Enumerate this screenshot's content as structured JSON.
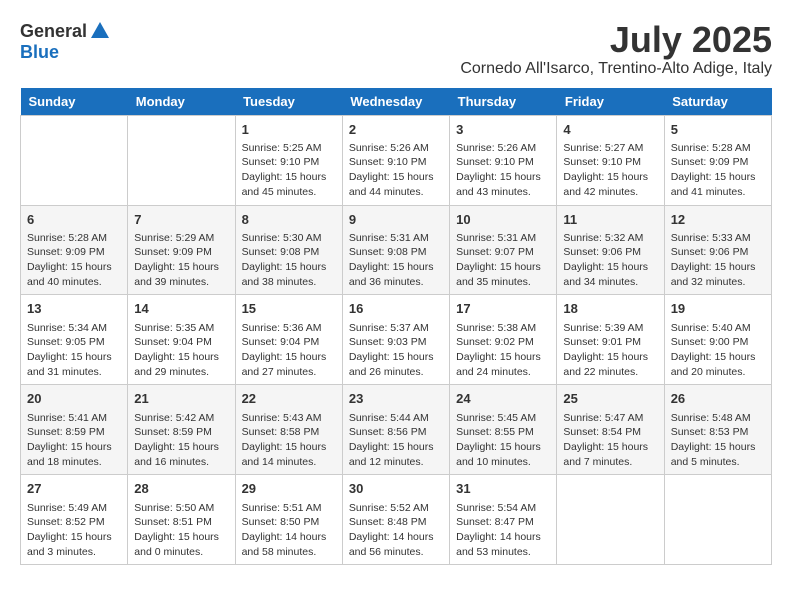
{
  "header": {
    "logo_line1": "General",
    "logo_line2": "Blue",
    "month": "July 2025",
    "location": "Cornedo All'Isarco, Trentino-Alto Adige, Italy"
  },
  "days_of_week": [
    "Sunday",
    "Monday",
    "Tuesday",
    "Wednesday",
    "Thursday",
    "Friday",
    "Saturday"
  ],
  "weeks": [
    [
      {
        "day": "",
        "content": ""
      },
      {
        "day": "",
        "content": ""
      },
      {
        "day": "1",
        "content": "Sunrise: 5:25 AM\nSunset: 9:10 PM\nDaylight: 15 hours and 45 minutes."
      },
      {
        "day": "2",
        "content": "Sunrise: 5:26 AM\nSunset: 9:10 PM\nDaylight: 15 hours and 44 minutes."
      },
      {
        "day": "3",
        "content": "Sunrise: 5:26 AM\nSunset: 9:10 PM\nDaylight: 15 hours and 43 minutes."
      },
      {
        "day": "4",
        "content": "Sunrise: 5:27 AM\nSunset: 9:10 PM\nDaylight: 15 hours and 42 minutes."
      },
      {
        "day": "5",
        "content": "Sunrise: 5:28 AM\nSunset: 9:09 PM\nDaylight: 15 hours and 41 minutes."
      }
    ],
    [
      {
        "day": "6",
        "content": "Sunrise: 5:28 AM\nSunset: 9:09 PM\nDaylight: 15 hours and 40 minutes."
      },
      {
        "day": "7",
        "content": "Sunrise: 5:29 AM\nSunset: 9:09 PM\nDaylight: 15 hours and 39 minutes."
      },
      {
        "day": "8",
        "content": "Sunrise: 5:30 AM\nSunset: 9:08 PM\nDaylight: 15 hours and 38 minutes."
      },
      {
        "day": "9",
        "content": "Sunrise: 5:31 AM\nSunset: 9:08 PM\nDaylight: 15 hours and 36 minutes."
      },
      {
        "day": "10",
        "content": "Sunrise: 5:31 AM\nSunset: 9:07 PM\nDaylight: 15 hours and 35 minutes."
      },
      {
        "day": "11",
        "content": "Sunrise: 5:32 AM\nSunset: 9:06 PM\nDaylight: 15 hours and 34 minutes."
      },
      {
        "day": "12",
        "content": "Sunrise: 5:33 AM\nSunset: 9:06 PM\nDaylight: 15 hours and 32 minutes."
      }
    ],
    [
      {
        "day": "13",
        "content": "Sunrise: 5:34 AM\nSunset: 9:05 PM\nDaylight: 15 hours and 31 minutes."
      },
      {
        "day": "14",
        "content": "Sunrise: 5:35 AM\nSunset: 9:04 PM\nDaylight: 15 hours and 29 minutes."
      },
      {
        "day": "15",
        "content": "Sunrise: 5:36 AM\nSunset: 9:04 PM\nDaylight: 15 hours and 27 minutes."
      },
      {
        "day": "16",
        "content": "Sunrise: 5:37 AM\nSunset: 9:03 PM\nDaylight: 15 hours and 26 minutes."
      },
      {
        "day": "17",
        "content": "Sunrise: 5:38 AM\nSunset: 9:02 PM\nDaylight: 15 hours and 24 minutes."
      },
      {
        "day": "18",
        "content": "Sunrise: 5:39 AM\nSunset: 9:01 PM\nDaylight: 15 hours and 22 minutes."
      },
      {
        "day": "19",
        "content": "Sunrise: 5:40 AM\nSunset: 9:00 PM\nDaylight: 15 hours and 20 minutes."
      }
    ],
    [
      {
        "day": "20",
        "content": "Sunrise: 5:41 AM\nSunset: 8:59 PM\nDaylight: 15 hours and 18 minutes."
      },
      {
        "day": "21",
        "content": "Sunrise: 5:42 AM\nSunset: 8:59 PM\nDaylight: 15 hours and 16 minutes."
      },
      {
        "day": "22",
        "content": "Sunrise: 5:43 AM\nSunset: 8:58 PM\nDaylight: 15 hours and 14 minutes."
      },
      {
        "day": "23",
        "content": "Sunrise: 5:44 AM\nSunset: 8:56 PM\nDaylight: 15 hours and 12 minutes."
      },
      {
        "day": "24",
        "content": "Sunrise: 5:45 AM\nSunset: 8:55 PM\nDaylight: 15 hours and 10 minutes."
      },
      {
        "day": "25",
        "content": "Sunrise: 5:47 AM\nSunset: 8:54 PM\nDaylight: 15 hours and 7 minutes."
      },
      {
        "day": "26",
        "content": "Sunrise: 5:48 AM\nSunset: 8:53 PM\nDaylight: 15 hours and 5 minutes."
      }
    ],
    [
      {
        "day": "27",
        "content": "Sunrise: 5:49 AM\nSunset: 8:52 PM\nDaylight: 15 hours and 3 minutes."
      },
      {
        "day": "28",
        "content": "Sunrise: 5:50 AM\nSunset: 8:51 PM\nDaylight: 15 hours and 0 minutes."
      },
      {
        "day": "29",
        "content": "Sunrise: 5:51 AM\nSunset: 8:50 PM\nDaylight: 14 hours and 58 minutes."
      },
      {
        "day": "30",
        "content": "Sunrise: 5:52 AM\nSunset: 8:48 PM\nDaylight: 14 hours and 56 minutes."
      },
      {
        "day": "31",
        "content": "Sunrise: 5:54 AM\nSunset: 8:47 PM\nDaylight: 14 hours and 53 minutes."
      },
      {
        "day": "",
        "content": ""
      },
      {
        "day": "",
        "content": ""
      }
    ]
  ]
}
